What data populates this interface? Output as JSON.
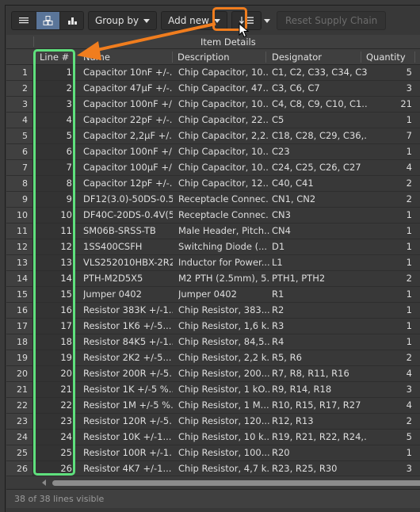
{
  "toolbar": {
    "view_buttons": [
      {
        "icon": "list-view-icon",
        "active": false
      },
      {
        "icon": "supply-chain-view-icon",
        "active": true
      },
      {
        "icon": "chart-view-icon",
        "active": false
      }
    ],
    "group_by_label": "Group by",
    "add_new_label": "Add new",
    "sort_icon": "sort-lines-icon",
    "reset_supply_chain_label": "Reset Supply Chain"
  },
  "grid": {
    "group_header": "Item Details",
    "columns": [
      "Line #",
      "Name",
      "Description",
      "Designator",
      "Quantity"
    ],
    "rows": [
      {
        "n": "1",
        "line": "1",
        "name": "Capacitor 10nF +/-...",
        "desc": "Chip Capacitor, 10...",
        "desig": "C1, C2, C33, C34, C35",
        "qty": "5"
      },
      {
        "n": "2",
        "line": "2",
        "name": "Capacitor 47µF +/-...",
        "desc": "Chip Capacitor, 47...",
        "desig": "C3, C6, C7",
        "qty": "3"
      },
      {
        "n": "3",
        "line": "3",
        "name": "Capacitor 100nF +/...",
        "desc": "Chip Capacitor, 10...",
        "desig": "C4, C8, C9, C10, C1...",
        "qty": "21"
      },
      {
        "n": "4",
        "line": "4",
        "name": "Capacitor 22pF +/-...",
        "desc": "Chip Capacitor, 22...",
        "desig": "C5",
        "qty": "1"
      },
      {
        "n": "5",
        "line": "5",
        "name": "Capacitor 2,2µF +/...",
        "desc": "Chip Capacitor, 2,2...",
        "desig": "C18, C28, C29, C36,...",
        "qty": "7"
      },
      {
        "n": "6",
        "line": "6",
        "name": "Capacitor 100nF +/...",
        "desc": "Chip Capacitor, 10...",
        "desig": "C23",
        "qty": "1"
      },
      {
        "n": "7",
        "line": "7",
        "name": "Capacitor 100µF +/...",
        "desc": "Chip Capacitor, 10...",
        "desig": "C24, C25, C26, C27",
        "qty": "4"
      },
      {
        "n": "8",
        "line": "8",
        "name": "Capacitor 12pF +/-...",
        "desc": "Chip Capacitor, 12...",
        "desig": "C40, C41",
        "qty": "2"
      },
      {
        "n": "9",
        "line": "9",
        "name": "DF12(3.0)-50DS-0.5...",
        "desc": "Receptacle Connec...",
        "desig": "CN1, CN2",
        "qty": "2"
      },
      {
        "n": "10",
        "line": "10",
        "name": "DF40C-20DS-0.4V(51)",
        "desc": "Receptacle Connec...",
        "desig": "CN3",
        "qty": "1"
      },
      {
        "n": "11",
        "line": "11",
        "name": "SM06B-SRSS-TB",
        "desc": "Male Header, Pitch...",
        "desig": "CN4",
        "qty": "1"
      },
      {
        "n": "12",
        "line": "12",
        "name": "1SS400CSFH",
        "desc": "Switching Diode (...",
        "desig": "D1",
        "qty": "1"
      },
      {
        "n": "13",
        "line": "13",
        "name": "VLS252010HBX-2R2...",
        "desc": "Inductor for Power...",
        "desig": "L1",
        "qty": "1"
      },
      {
        "n": "14",
        "line": "14",
        "name": "PTH-M2D5X5",
        "desc": "M2 PTH (2.5mm), 5...",
        "desig": "PTH1, PTH2",
        "qty": "2"
      },
      {
        "n": "15",
        "line": "15",
        "name": "Jumper 0402",
        "desc": "Jumper 0402",
        "desig": "R1",
        "qty": "1"
      },
      {
        "n": "16",
        "line": "16",
        "name": "Resistor 383K +/-1...",
        "desc": "Chip Resistor, 383...",
        "desig": "R2",
        "qty": "1"
      },
      {
        "n": "17",
        "line": "17",
        "name": "Resistor 1K6 +/-5...",
        "desc": "Chip Resistor, 1,6 k...",
        "desig": "R3",
        "qty": "1"
      },
      {
        "n": "18",
        "line": "18",
        "name": "Resistor 84K5 +/-1...",
        "desc": "Chip Resistor, 84,5...",
        "desig": "R4",
        "qty": "1"
      },
      {
        "n": "19",
        "line": "19",
        "name": "Resistor 2K2  +/-5...",
        "desc": "Chip Resistor, 2,2 k...",
        "desig": "R5, R6",
        "qty": "2"
      },
      {
        "n": "20",
        "line": "20",
        "name": "Resistor 200R +/-5...",
        "desc": "Chip Resistor, 200...",
        "desig": "R7, R8, R11, R16",
        "qty": "4"
      },
      {
        "n": "21",
        "line": "21",
        "name": "Resistor 1K +/-5 %...",
        "desc": "Chip Resistor, 1 kO...",
        "desig": "R9, R14, R18",
        "qty": "3"
      },
      {
        "n": "22",
        "line": "22",
        "name": "Resistor 1M +/-5 %...",
        "desc": "Chip Resistor, 1 M...",
        "desig": "R10, R15, R17, R27",
        "qty": "4"
      },
      {
        "n": "23",
        "line": "23",
        "name": "Resistor 120R +/-5...",
        "desc": "Chip Resistor, 120...",
        "desig": "R12, R13",
        "qty": "2"
      },
      {
        "n": "24",
        "line": "24",
        "name": "Resistor 10K  +/-1...",
        "desc": "Chip Resistor, 10 k...",
        "desig": "R19, R21, R22, R24,...",
        "qty": "5"
      },
      {
        "n": "25",
        "line": "25",
        "name": "Resistor 100R +/-1...",
        "desc": "Chip Resistor, 100...",
        "desig": "R20",
        "qty": "1"
      },
      {
        "n": "26",
        "line": "26",
        "name": "Resistor 4K7  +/-1...",
        "desc": "Chip Resistor, 4,7 k...",
        "desig": "R23, R25, R30",
        "qty": "3"
      }
    ]
  },
  "status": {
    "text": "38 of 38 lines visible"
  },
  "annotations": {
    "orange": "#f07d1e",
    "green": "#5fe07d",
    "active_view": "#5a7599"
  }
}
